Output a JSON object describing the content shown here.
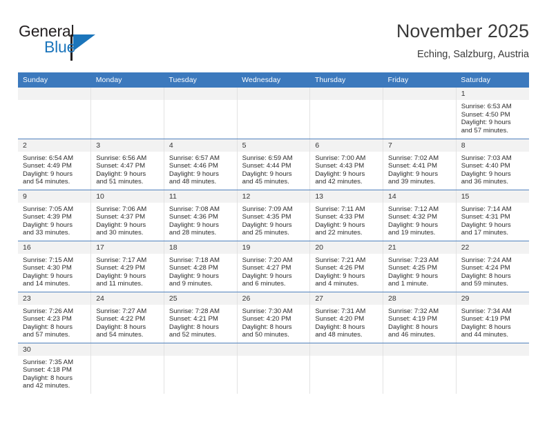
{
  "brand": {
    "word_one": "General",
    "word_two": "Blue",
    "logo_icon": "triangle-flag-icon",
    "color_blue": "#1b75bb",
    "color_dark": "#231f20"
  },
  "header": {
    "title": "November 2025",
    "location": "Eching, Salzburg, Austria"
  },
  "theme": {
    "header_blue": "#3c79bd",
    "row_divider_blue": "#4e80bd",
    "daynum_band": "#f2f2f2",
    "column_divider": "#e2e2e2"
  },
  "weekdays": [
    "Sunday",
    "Monday",
    "Tuesday",
    "Wednesday",
    "Thursday",
    "Friday",
    "Saturday"
  ],
  "weeks": [
    [
      {
        "day": "",
        "info": "",
        "empty": true
      },
      {
        "day": "",
        "info": "",
        "empty": true
      },
      {
        "day": "",
        "info": "",
        "empty": true
      },
      {
        "day": "",
        "info": "",
        "empty": true
      },
      {
        "day": "",
        "info": "",
        "empty": true
      },
      {
        "day": "",
        "info": "",
        "empty": true
      },
      {
        "day": "1",
        "info": "Sunrise: 6:53 AM\nSunset: 4:50 PM\nDaylight: 9 hours\nand 57 minutes.",
        "empty": false
      }
    ],
    [
      {
        "day": "2",
        "info": "Sunrise: 6:54 AM\nSunset: 4:49 PM\nDaylight: 9 hours\nand 54 minutes.",
        "empty": false
      },
      {
        "day": "3",
        "info": "Sunrise: 6:56 AM\nSunset: 4:47 PM\nDaylight: 9 hours\nand 51 minutes.",
        "empty": false
      },
      {
        "day": "4",
        "info": "Sunrise: 6:57 AM\nSunset: 4:46 PM\nDaylight: 9 hours\nand 48 minutes.",
        "empty": false
      },
      {
        "day": "5",
        "info": "Sunrise: 6:59 AM\nSunset: 4:44 PM\nDaylight: 9 hours\nand 45 minutes.",
        "empty": false
      },
      {
        "day": "6",
        "info": "Sunrise: 7:00 AM\nSunset: 4:43 PM\nDaylight: 9 hours\nand 42 minutes.",
        "empty": false
      },
      {
        "day": "7",
        "info": "Sunrise: 7:02 AM\nSunset: 4:41 PM\nDaylight: 9 hours\nand 39 minutes.",
        "empty": false
      },
      {
        "day": "8",
        "info": "Sunrise: 7:03 AM\nSunset: 4:40 PM\nDaylight: 9 hours\nand 36 minutes.",
        "empty": false
      }
    ],
    [
      {
        "day": "9",
        "info": "Sunrise: 7:05 AM\nSunset: 4:39 PM\nDaylight: 9 hours\nand 33 minutes.",
        "empty": false
      },
      {
        "day": "10",
        "info": "Sunrise: 7:06 AM\nSunset: 4:37 PM\nDaylight: 9 hours\nand 30 minutes.",
        "empty": false
      },
      {
        "day": "11",
        "info": "Sunrise: 7:08 AM\nSunset: 4:36 PM\nDaylight: 9 hours\nand 28 minutes.",
        "empty": false
      },
      {
        "day": "12",
        "info": "Sunrise: 7:09 AM\nSunset: 4:35 PM\nDaylight: 9 hours\nand 25 minutes.",
        "empty": false
      },
      {
        "day": "13",
        "info": "Sunrise: 7:11 AM\nSunset: 4:33 PM\nDaylight: 9 hours\nand 22 minutes.",
        "empty": false
      },
      {
        "day": "14",
        "info": "Sunrise: 7:12 AM\nSunset: 4:32 PM\nDaylight: 9 hours\nand 19 minutes.",
        "empty": false
      },
      {
        "day": "15",
        "info": "Sunrise: 7:14 AM\nSunset: 4:31 PM\nDaylight: 9 hours\nand 17 minutes.",
        "empty": false
      }
    ],
    [
      {
        "day": "16",
        "info": "Sunrise: 7:15 AM\nSunset: 4:30 PM\nDaylight: 9 hours\nand 14 minutes.",
        "empty": false
      },
      {
        "day": "17",
        "info": "Sunrise: 7:17 AM\nSunset: 4:29 PM\nDaylight: 9 hours\nand 11 minutes.",
        "empty": false
      },
      {
        "day": "18",
        "info": "Sunrise: 7:18 AM\nSunset: 4:28 PM\nDaylight: 9 hours\nand 9 minutes.",
        "empty": false
      },
      {
        "day": "19",
        "info": "Sunrise: 7:20 AM\nSunset: 4:27 PM\nDaylight: 9 hours\nand 6 minutes.",
        "empty": false
      },
      {
        "day": "20",
        "info": "Sunrise: 7:21 AM\nSunset: 4:26 PM\nDaylight: 9 hours\nand 4 minutes.",
        "empty": false
      },
      {
        "day": "21",
        "info": "Sunrise: 7:23 AM\nSunset: 4:25 PM\nDaylight: 9 hours\nand 1 minute.",
        "empty": false
      },
      {
        "day": "22",
        "info": "Sunrise: 7:24 AM\nSunset: 4:24 PM\nDaylight: 8 hours\nand 59 minutes.",
        "empty": false
      }
    ],
    [
      {
        "day": "23",
        "info": "Sunrise: 7:26 AM\nSunset: 4:23 PM\nDaylight: 8 hours\nand 57 minutes.",
        "empty": false
      },
      {
        "day": "24",
        "info": "Sunrise: 7:27 AM\nSunset: 4:22 PM\nDaylight: 8 hours\nand 54 minutes.",
        "empty": false
      },
      {
        "day": "25",
        "info": "Sunrise: 7:28 AM\nSunset: 4:21 PM\nDaylight: 8 hours\nand 52 minutes.",
        "empty": false
      },
      {
        "day": "26",
        "info": "Sunrise: 7:30 AM\nSunset: 4:20 PM\nDaylight: 8 hours\nand 50 minutes.",
        "empty": false
      },
      {
        "day": "27",
        "info": "Sunrise: 7:31 AM\nSunset: 4:20 PM\nDaylight: 8 hours\nand 48 minutes.",
        "empty": false
      },
      {
        "day": "28",
        "info": "Sunrise: 7:32 AM\nSunset: 4:19 PM\nDaylight: 8 hours\nand 46 minutes.",
        "empty": false
      },
      {
        "day": "29",
        "info": "Sunrise: 7:34 AM\nSunset: 4:19 PM\nDaylight: 8 hours\nand 44 minutes.",
        "empty": false
      }
    ],
    [
      {
        "day": "30",
        "info": "Sunrise: 7:35 AM\nSunset: 4:18 PM\nDaylight: 8 hours\nand 42 minutes.",
        "empty": false
      },
      {
        "day": "",
        "info": "",
        "empty": true
      },
      {
        "day": "",
        "info": "",
        "empty": true
      },
      {
        "day": "",
        "info": "",
        "empty": true
      },
      {
        "day": "",
        "info": "",
        "empty": true
      },
      {
        "day": "",
        "info": "",
        "empty": true
      },
      {
        "day": "",
        "info": "",
        "empty": true
      }
    ]
  ]
}
